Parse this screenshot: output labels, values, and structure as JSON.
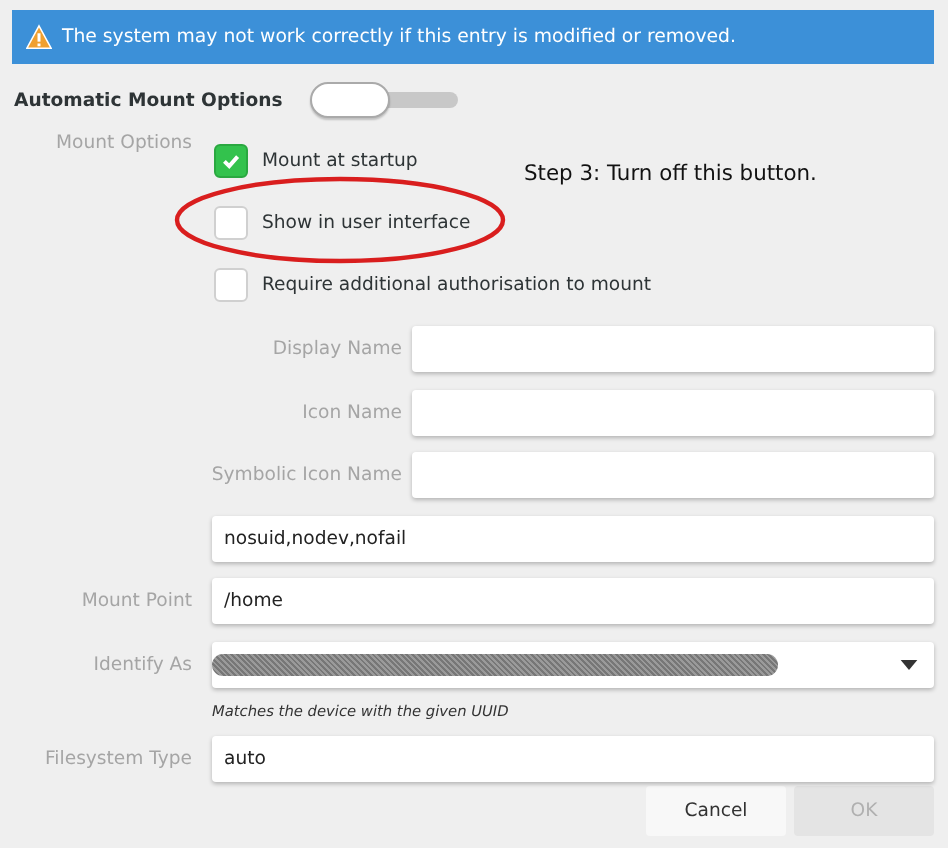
{
  "banner": {
    "text": "The system may not work correctly if this entry is modified or removed."
  },
  "automatic_mount": {
    "label": "Automatic Mount Options",
    "on": false
  },
  "mount_options": {
    "label": "Mount Options",
    "checkboxes": [
      {
        "label": "Mount at startup",
        "checked": true
      },
      {
        "label": "Show in user interface",
        "checked": false
      },
      {
        "label": "Require additional authorisation to mount",
        "checked": false
      }
    ]
  },
  "annotation": {
    "text": "Step 3: Turn off this button."
  },
  "fields": [
    {
      "kind": "indented",
      "label": "Display Name"
    },
    {
      "kind": "indented",
      "label": "Icon Name"
    },
    {
      "kind": "indented",
      "label": "Symbolic Icon Name"
    },
    {
      "kind": "plain",
      "value": "nosuid,nodev,nofail"
    },
    {
      "kind": "text",
      "label": "Mount Point",
      "value": "/home"
    },
    {
      "kind": "dropdown",
      "label": "Identify As",
      "redacted": true,
      "hint": "Matches the device with the given UUID"
    },
    {
      "kind": "text",
      "label": "Filesystem Type",
      "value": "auto"
    }
  ],
  "buttons": [
    {
      "label": "Cancel",
      "disabled": false
    },
    {
      "label": "OK",
      "disabled": true
    }
  ]
}
